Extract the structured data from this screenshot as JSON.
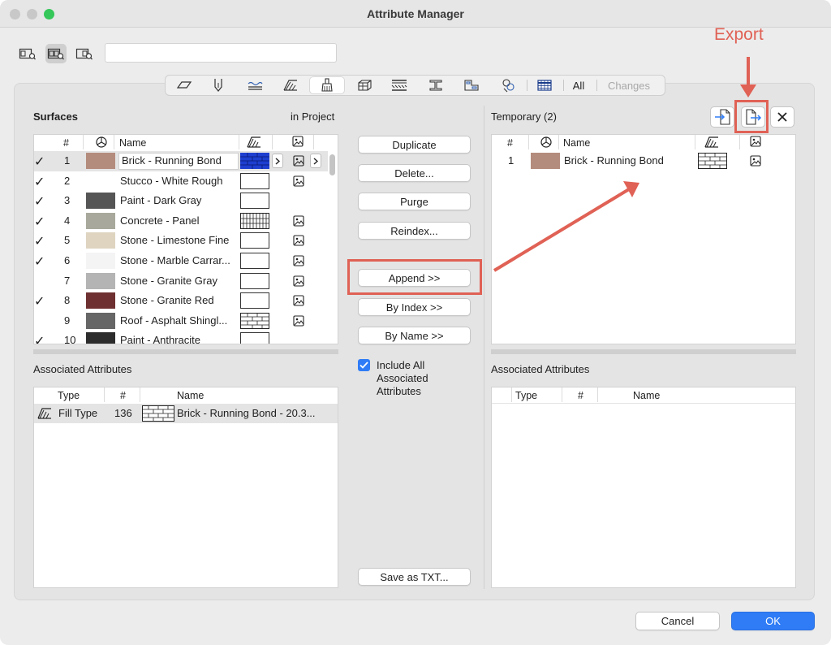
{
  "window": {
    "title": "Attribute Manager",
    "traffic_colors": [
      "#c8c8c8",
      "#c8c8c8",
      "#35c759"
    ]
  },
  "search": {
    "value": ""
  },
  "tabs": {
    "all_label": "All",
    "changes_label": "Changes"
  },
  "annotation": {
    "export_label": "Export",
    "color": "#e06155"
  },
  "left": {
    "title": "Surfaces",
    "in_project": "in Project",
    "columns": {
      "num": "#",
      "name": "Name"
    },
    "rows": [
      {
        "check": "✓",
        "num": "1",
        "name": "Brick - Running Bond",
        "color": "#b48c7d",
        "pattern": "brick-blue",
        "has_image": true
      },
      {
        "check": "✓",
        "num": "2",
        "name": "Stucco - White Rough",
        "color": "#ffffff",
        "pattern": "empty",
        "has_image": true
      },
      {
        "check": "✓",
        "num": "3",
        "name": "Paint - Dark Gray",
        "color": "#555555",
        "pattern": "empty",
        "has_image": false
      },
      {
        "check": "✓",
        "num": "4",
        "name": "Concrete - Panel",
        "color": "#a8a89c",
        "pattern": "grid",
        "has_image": true
      },
      {
        "check": "✓",
        "num": "5",
        "name": "Stone - Limestone Fine",
        "color": "#ded4c0",
        "pattern": "empty",
        "has_image": true
      },
      {
        "check": "✓",
        "num": "6",
        "name": "Stone - Marble Carrar...",
        "color": "#f4f4f4",
        "pattern": "empty",
        "has_image": true
      },
      {
        "check": "",
        "num": "7",
        "name": "Stone - Granite Gray",
        "color": "#b4b4b4",
        "pattern": "empty",
        "has_image": true
      },
      {
        "check": "✓",
        "num": "8",
        "name": "Stone - Granite Red",
        "color": "#6e3030",
        "pattern": "empty",
        "has_image": true
      },
      {
        "check": "",
        "num": "9",
        "name": "Roof - Asphalt Shingl...",
        "color": "#666666",
        "pattern": "brick",
        "has_image": true
      },
      {
        "check": "✓",
        "num": "10",
        "name": "Paint - Anthracite",
        "color": "#2c2c2c",
        "pattern": "empty",
        "has_image": false
      }
    ]
  },
  "left_assoc": {
    "title": "Associated Attributes",
    "columns": {
      "type": "Type",
      "num": "#",
      "name": "Name"
    },
    "rows": [
      {
        "type": "Fill Type",
        "num": "136",
        "name": "Brick - Running Bond - 20.3..."
      }
    ]
  },
  "middle": {
    "duplicate": "Duplicate",
    "delete": "Delete...",
    "purge": "Purge",
    "reindex": "Reindex...",
    "append": "Append >>",
    "by_index": "By Index >>",
    "by_name": "By Name >>",
    "include_all": "Include All",
    "include_all_2": "Associated",
    "include_all_3": "Attributes",
    "save_txt": "Save as TXT..."
  },
  "right": {
    "title": "Temporary (2)",
    "columns": {
      "num": "#",
      "name": "Name"
    },
    "rows": [
      {
        "num": "1",
        "name": "Brick - Running Bond",
        "color": "#b48c7d"
      }
    ]
  },
  "right_assoc": {
    "title": "Associated Attributes",
    "columns": {
      "type": "Type",
      "num": "#",
      "name": "Name"
    }
  },
  "footer": {
    "cancel": "Cancel",
    "ok": "OK",
    "ok_color": "#2f7cf6"
  }
}
